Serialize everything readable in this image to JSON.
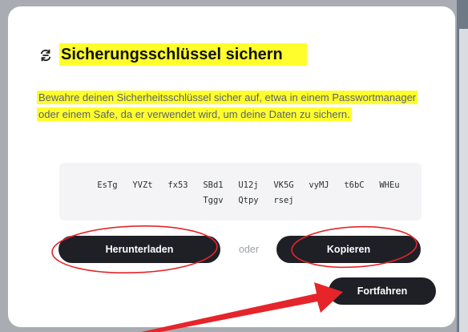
{
  "dialog": {
    "title": "Sicherungsschlüssel sichern",
    "title_icon": "sync-arrows-icon",
    "description": "Bewahre deinen Sicherheitsschlüssel sicher auf, etwa in einem Passwortmanager oder einem Safe, da er verwendet wird, um deine Daten zu sichern.",
    "key_words": [
      "EsTg",
      "YVZt",
      "fx53",
      "SBd1",
      "U12j",
      "VK5G",
      "vyMJ",
      "t6bC",
      "WHEu",
      "Tggv",
      "Qtpy",
      "rsej"
    ],
    "download_label": "Herunterladen",
    "separator_label": "oder",
    "copy_label": "Kopieren",
    "continue_label": "Fortfahren"
  },
  "colors": {
    "highlight": "#fffd2b",
    "button_bg": "#1e2026",
    "annotation_red": "#e5252a"
  }
}
